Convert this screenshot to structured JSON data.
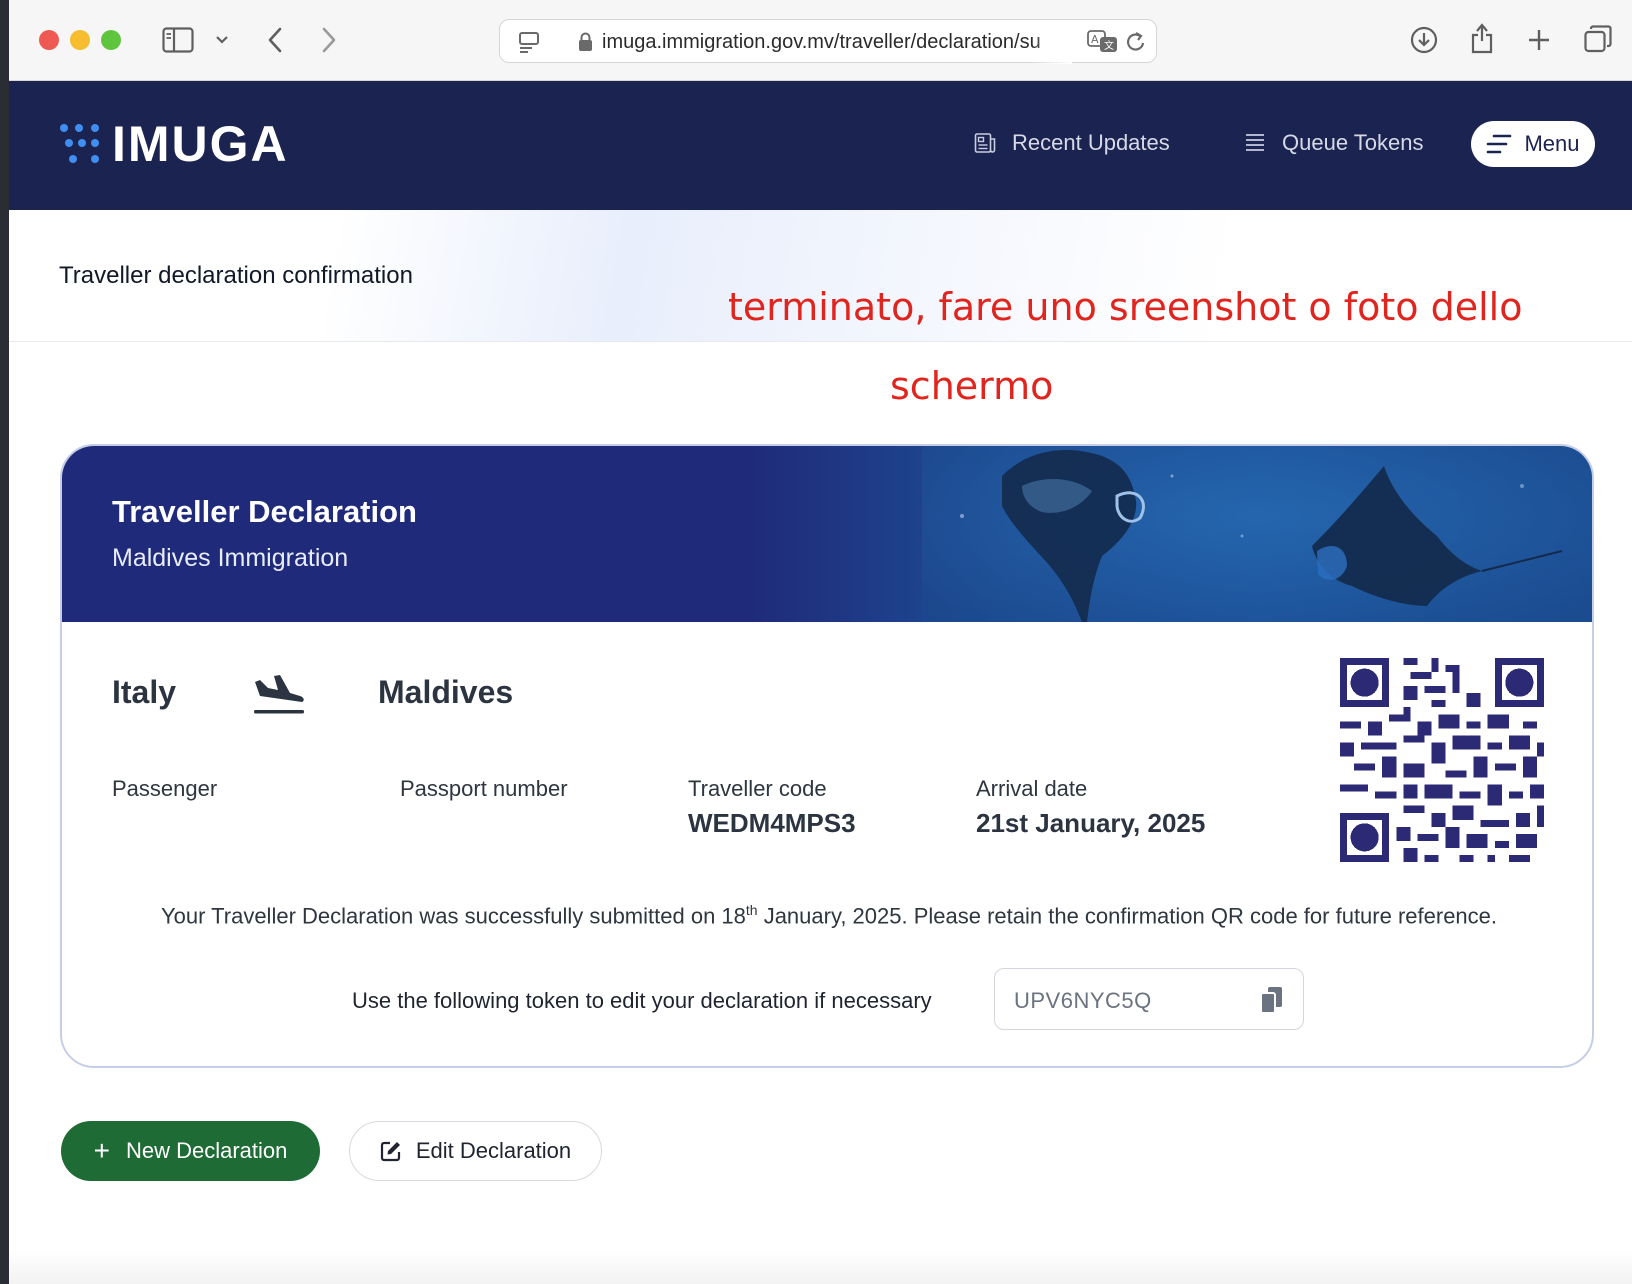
{
  "browser": {
    "url": "imuga.immigration.gov.mv/traveller/declaration/su",
    "icons": [
      "sidebar-icon",
      "chevron-down-icon",
      "back-icon",
      "forward-icon",
      "page-menu-icon",
      "lock-icon",
      "translate-icon",
      "reload-icon",
      "download-icon",
      "share-icon",
      "new-tab-icon",
      "tabs-overview-icon"
    ]
  },
  "header": {
    "logo_text": "IMUGA",
    "nav": {
      "recent_updates": "Recent Updates",
      "queue_tokens": "Queue Tokens",
      "menu": "Menu"
    },
    "colors": {
      "background": "#1b2350",
      "logo_dots": "#3f8ef2"
    }
  },
  "page": {
    "title": "Traveller declaration confirmation"
  },
  "annotation": {
    "line1": "terminato, fare uno sreenshot o foto dello",
    "line2": "schermo",
    "color": "#e0241e"
  },
  "card": {
    "title": "Traveller Declaration",
    "subtitle": "Maldives Immigration",
    "from_country": "Italy",
    "to_country": "Maldives",
    "fields": {
      "passenger_label": "Passenger",
      "passport_label": "Passport number",
      "traveller_code_label": "Traveller code",
      "traveller_code": "WEDM4MPS3",
      "arrival_date_label": "Arrival date",
      "arrival_date": "21st January, 2025"
    },
    "message": {
      "before": "Your Traveller Declaration was successfully submitted on 18",
      "sup": "th",
      "after": " January, 2025. Please retain the confirmation QR code for future reference."
    },
    "token_label": "Use the following token to edit your declaration if necessary",
    "token_value": "UPV6NYC5Q",
    "qr_color": "#2c2a75"
  },
  "actions": {
    "new_declaration": "New Declaration",
    "edit_declaration": "Edit Declaration",
    "new_color": "#1f6b35"
  }
}
